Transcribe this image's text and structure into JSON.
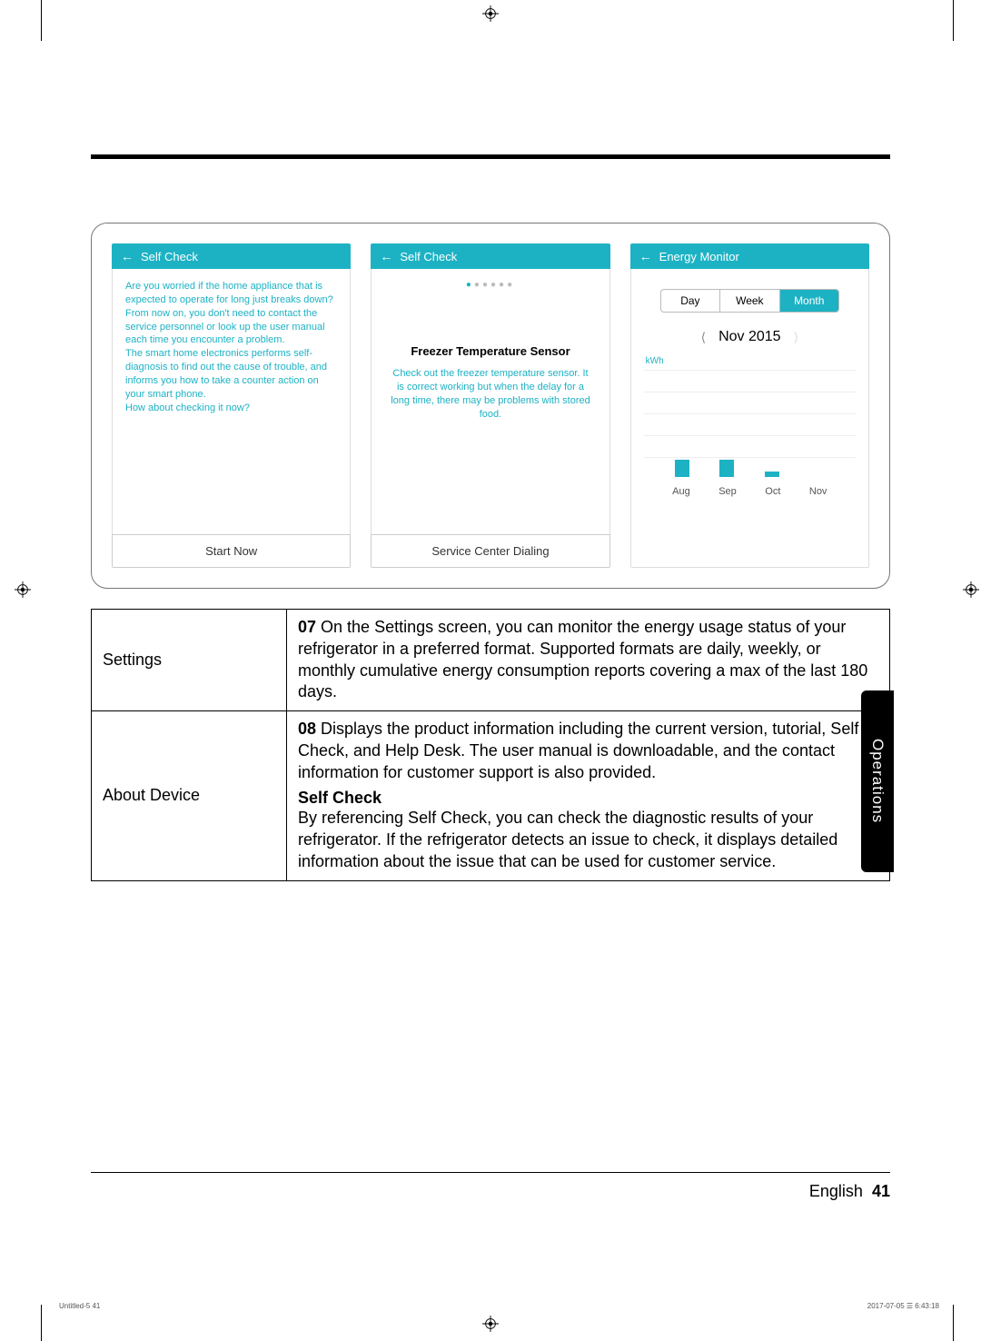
{
  "screens": {
    "self_check_1": {
      "title": "Self Check",
      "intro": "Are you worried if the home appliance that is expected to operate for long just breaks down?\nFrom now on, you don't need to contact the service personnel or look up the user manual each time you encounter a problem.\nThe smart home electronics performs self-diagnosis to find out the cause of trouble, and informs you how to take a counter action on your smart phone.\nHow about checking it now?",
      "button": "Start Now"
    },
    "self_check_2": {
      "title": "Self Check",
      "sensor_title": "Freezer Temperature Sensor",
      "sensor_desc": "Check out the freezer temperature sensor. It is correct working but when the delay for a long time, there may be problems with stored food.",
      "button": "Service Center Dialing"
    },
    "energy_monitor": {
      "title": "Energy Monitor",
      "tabs": {
        "day": "Day",
        "week": "Week",
        "month": "Month"
      },
      "period": "Nov 2015",
      "y_unit": "kWh"
    }
  },
  "chart_data": {
    "type": "bar",
    "categories": [
      "Aug",
      "Sep",
      "Oct",
      "Nov"
    ],
    "values": [
      20,
      20,
      6,
      0
    ],
    "xlabel": "",
    "ylabel": "kWh",
    "ylim": [
      0,
      100
    ]
  },
  "table": {
    "row1": {
      "label": "Settings",
      "num": "07",
      "text": " On the Settings screen, you can monitor the energy usage status of your refrigerator in a preferred format. Supported formats are daily, weekly, or monthly cumulative energy consumption reports covering a max of the last 180 days."
    },
    "row2": {
      "label": "About Device",
      "num": "08",
      "text1": " Displays the product information including the current version, tutorial, Self Check, and Help Desk. The user manual is downloadable, and the contact information for customer support is also provided.",
      "subhead": "Self Check",
      "text2": "By referencing Self Check, you can check the diagnostic results of your refrigerator. If the refrigerator detects an issue to check, it displays detailed information about the issue that can be used for customer service."
    }
  },
  "side_tab": "Operations",
  "footer": {
    "lang": "English",
    "page": "41"
  },
  "print": {
    "left": "Untitled-5   41",
    "right": "2017-07-05   ☰ 6:43:18"
  }
}
